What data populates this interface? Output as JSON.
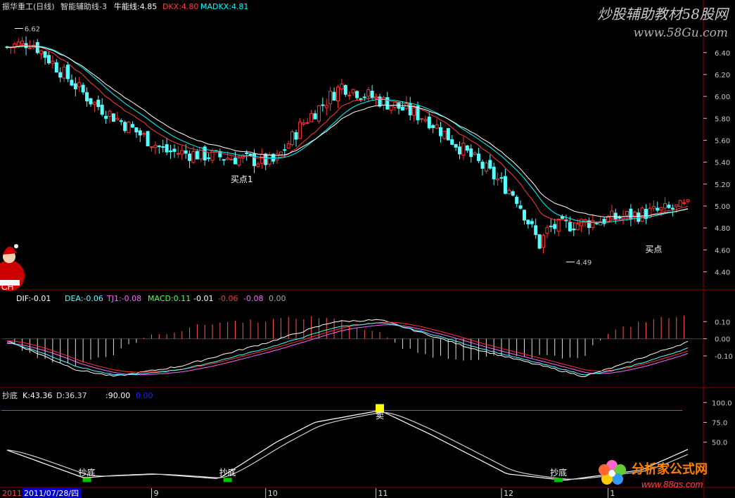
{
  "headers": {
    "main": {
      "stock_name": "振华重工(日线)",
      "indicator_name": "智能辅助线-3",
      "bull_label": "牛能线:4.85",
      "dkx_label": "DKX:4.80",
      "madkx_label": "MADKX:4.81"
    },
    "macd": {
      "dif": "DIF:-0.01",
      "dea": "DEA:-0.06",
      "tj1": "TJ1:-0.08",
      "macd": "MACD:0.11",
      "v1": "-0.01",
      "v2": "-0.06",
      "v3": "-0.08",
      "v4": "0.00"
    },
    "kd": {
      "name": "抄底",
      "k": "K:43.36",
      "d": "D:36.37",
      "v1": ":90.00",
      "v2": "0.00"
    }
  },
  "watermarks": {
    "top_cn": "炒股辅助教材58股网",
    "top_url": "www.58Gu.com",
    "bottom_cn": "分析家公式网",
    "bottom_url": "www.88gs.com",
    "corner_badge": "CH"
  },
  "annotations": {
    "high_price": "6.62",
    "low_price": "4.49",
    "buy1": "买点1",
    "buy2": "买点",
    "sell": "卖",
    "chaodi": "抄底"
  },
  "date_axis": {
    "year": "2011",
    "current_date": "2011/07/28/四",
    "month_labels": [
      "9",
      "10",
      "11",
      "12",
      "1"
    ]
  },
  "colors": {
    "background": "#000000",
    "panel_border": "#8b0000",
    "up_candle": "#ff3333",
    "down_candle": "#54ffff",
    "dkx_line": "#ff3b3b",
    "madkx_line": "#00ffff",
    "bull_line": "#ffffff",
    "dif_line": "#ffffff",
    "dea_line": "#ff3333",
    "tj1_line": "#ff66ff",
    "macd_line": "#54ffff",
    "kd_k_line": "#ffffff",
    "kd_d_line": "#cfcfcf",
    "level_90": "#ff00ff",
    "chaodi_marker": "#00c800",
    "sell_marker": "#ffff00",
    "date_highlight": "#0000c8"
  },
  "chart_data": [
    {
      "type": "candlestick",
      "title": "振华重工(日线)",
      "y_ticks": [
        6.4,
        6.2,
        6.0,
        5.8,
        5.6,
        5.4,
        5.2,
        5.0,
        4.8,
        4.6,
        4.4
      ],
      "ylim": [
        4.3,
        6.7
      ],
      "anchors": {
        "x_positions": [
          0,
          8,
          28,
          52,
          88,
          97,
          110,
          138,
          167,
          175,
          178,
          225
        ],
        "y_values": [
          6.45,
          6.5,
          5.95,
          5.5,
          5.4,
          5.75,
          6.1,
          5.8,
          5.1,
          4.65,
          4.8,
          5.0
        ]
      },
      "n_bars": 180,
      "series": [
        {
          "name": "牛能线",
          "last_value": 4.85
        },
        {
          "name": "DKX",
          "last_value": 4.8
        },
        {
          "name": "MADKX",
          "last_value": 4.81
        }
      ],
      "annotations": [
        {
          "text": "6.62",
          "x_index": 2,
          "value": 6.62
        },
        {
          "text": "4.49",
          "x_index": 147,
          "value": 4.49
        },
        {
          "text": "买点1",
          "x_index": 61,
          "value": 5.36
        },
        {
          "text": "买点",
          "x_index": 170,
          "value": 4.72
        }
      ]
    },
    {
      "type": "line",
      "title": "MACD",
      "y_ticks": [
        0.1,
        0.0,
        -0.1
      ],
      "ylim": [
        -0.26,
        0.22
      ],
      "anchors": {
        "x_positions": [
          0,
          18,
          28,
          45,
          68,
          85,
          97,
          120,
          150,
          160,
          178
        ],
        "y_values": [
          -0.01,
          -0.18,
          -0.22,
          -0.16,
          -0.02,
          0.1,
          0.11,
          -0.05,
          -0.22,
          -0.15,
          -0.01
        ]
      },
      "series": [
        {
          "name": "DIF",
          "last_value": -0.01
        },
        {
          "name": "DEA",
          "last_value": -0.06
        },
        {
          "name": "TJ1",
          "last_value": -0.08
        },
        {
          "name": "MACD",
          "last_value": 0.11
        }
      ]
    },
    {
      "type": "line",
      "title": "抄底",
      "y_ticks": [
        100.0,
        75.0,
        50.0
      ],
      "ylim": [
        0,
        110
      ],
      "level_line": 90,
      "anchors": {
        "x_positions": [
          0,
          20,
          28,
          38,
          55,
          70,
          80,
          97,
          110,
          130,
          145,
          165,
          178
        ],
        "y_values": [
          40,
          5,
          8,
          10,
          4,
          50,
          75,
          90,
          60,
          10,
          2,
          15,
          43
        ]
      },
      "series": [
        {
          "name": "K",
          "last_value": 43.36
        },
        {
          "name": "D",
          "last_value": 36.37
        }
      ],
      "signals": [
        {
          "text": "抄底",
          "x_index": 21
        },
        {
          "text": "抄底",
          "x_index": 58
        },
        {
          "text": "卖",
          "x_index": 98
        },
        {
          "text": "抄底",
          "x_index": 145
        }
      ]
    }
  ]
}
